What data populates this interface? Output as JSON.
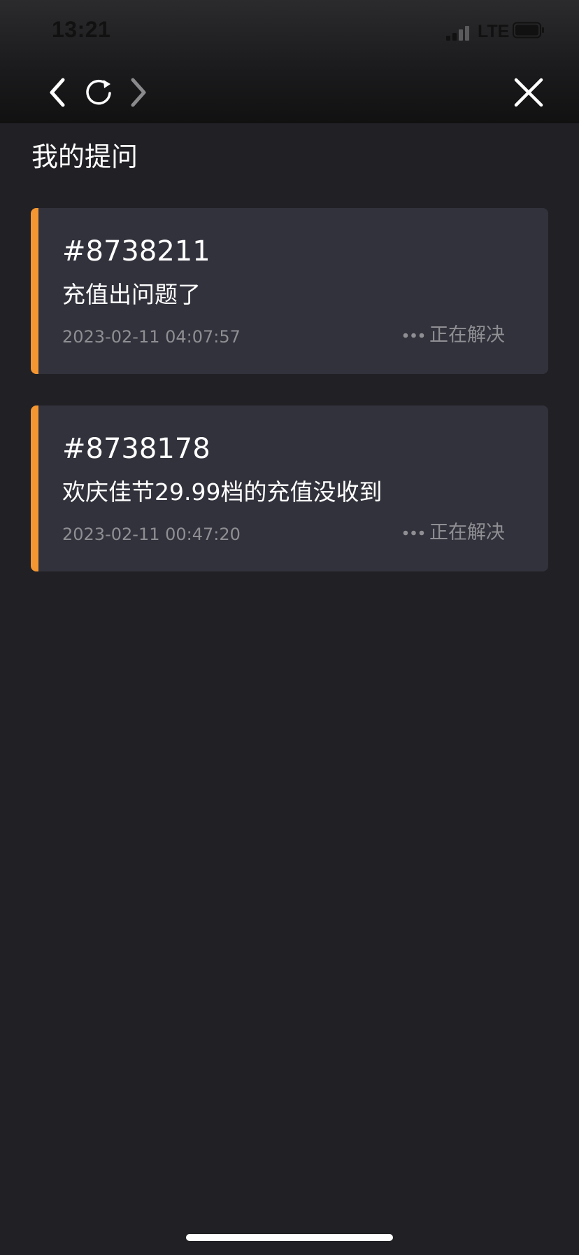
{
  "status_bar": {
    "time": "13:21",
    "network": "LTE"
  },
  "nav": {
    "back_icon": "chevron-left-icon",
    "refresh_icon": "refresh-icon",
    "forward_icon": "chevron-right-icon",
    "close_icon": "close-icon"
  },
  "page": {
    "title": "我的提问"
  },
  "tickets": [
    {
      "id": "#8738211",
      "title": "充值出问题了",
      "time": "2023-02-11 04:07:57",
      "status": "正在解决"
    },
    {
      "id": "#8738178",
      "title": "欢庆佳节29.99档的充值没收到",
      "time": "2023-02-11 00:47:20",
      "status": "正在解决"
    }
  ],
  "colors": {
    "background": "#212025",
    "card": "#32323c",
    "accent": "#f49732",
    "muted_text": "#8e8e93"
  }
}
